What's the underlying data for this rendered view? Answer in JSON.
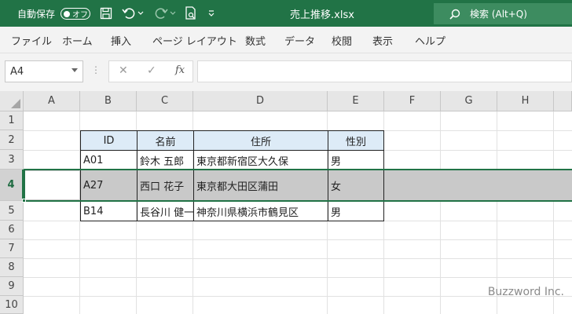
{
  "titlebar": {
    "autosave_label": "自動保存",
    "autosave_state": "オフ",
    "document_title": "売上推移.xlsx",
    "search_text": "検索 (Alt+Q)",
    "color": "#217346"
  },
  "ribbon": {
    "tabs": [
      "ファイル",
      "ホーム",
      "挿入",
      "ページ レイアウト",
      "数式",
      "データ",
      "校閲",
      "表示",
      "ヘルプ"
    ]
  },
  "formula_bar": {
    "name_box": "A4",
    "fx": "fx",
    "content": ""
  },
  "sheet": {
    "columns": [
      "A",
      "B",
      "C",
      "D",
      "E",
      "F",
      "G",
      "H"
    ],
    "rows": [
      "1",
      "2",
      "3",
      "4",
      "5",
      "6",
      "7",
      "8",
      "9",
      "10"
    ],
    "selected_row": "4",
    "table": {
      "headers": [
        "ID",
        "名前",
        "住所",
        "性別"
      ],
      "rows": [
        [
          "A01",
          "鈴木 五郎",
          "東京都新宿区大久保",
          "男"
        ],
        [
          "A27",
          "西口 花子",
          "東京都大田区蒲田",
          "女"
        ],
        [
          "B14",
          "長谷川 健一",
          "神奈川県横浜市鶴見区",
          "男"
        ]
      ]
    }
  },
  "watermark": "Buzzword Inc."
}
